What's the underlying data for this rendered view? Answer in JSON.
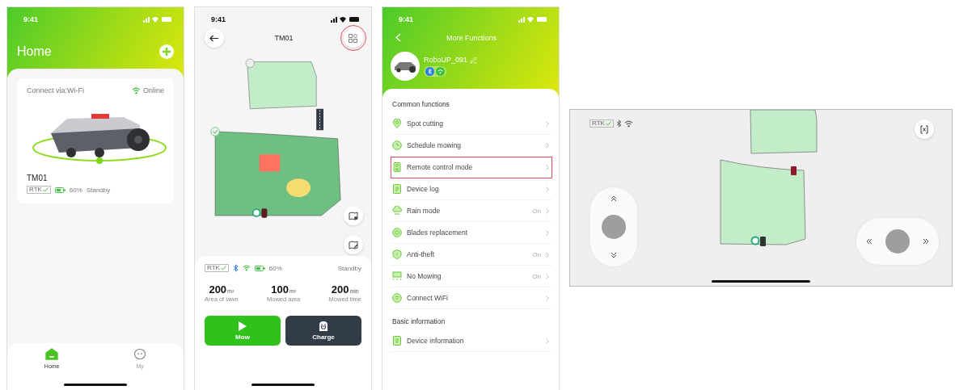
{
  "home_screen": {
    "status_time": "9:41",
    "title": "Home",
    "device_card": {
      "connection": "Connect via:Wi-Fi",
      "status": "Online",
      "name": "TM01",
      "rtk": "RTK",
      "battery": "60%",
      "state": "Standby"
    },
    "tab_bar": [
      {
        "label": "Home",
        "kind": "home",
        "selected": true
      },
      {
        "label": "My",
        "kind": "my",
        "selected": false
      }
    ]
  },
  "map_screen": {
    "status_time": "9:41",
    "title": "TM01",
    "menu_button": {
      "highlighted": true
    },
    "rtk": "RTK",
    "battery": "60%",
    "state": "Standby",
    "stats": [
      {
        "value": "200",
        "unit": "m²",
        "label": "Area of lawn"
      },
      {
        "value": "100",
        "unit": "m²",
        "label": "Mowed area"
      },
      {
        "value": "200",
        "unit": "min",
        "label": "Mowed time"
      }
    ],
    "buttons": [
      {
        "label": "Mow",
        "kind": "mow"
      },
      {
        "label": "Charge",
        "kind": "charge"
      }
    ]
  },
  "functions_screen": {
    "status_time": "9:41",
    "title": "More Functions",
    "device_name": "RoboUP_091",
    "sections": [
      {
        "title": "Common functions",
        "items": [
          {
            "label": "Spot cutting",
            "kind": "pin",
            "highlighted": false
          },
          {
            "label": "Schedule mowing",
            "kind": "clock",
            "highlighted": false
          },
          {
            "label": "Remote control mode",
            "kind": "remote",
            "highlighted": true
          },
          {
            "label": "Device log",
            "kind": "log",
            "highlighted": false
          },
          {
            "label": "Rain mode",
            "kind": "rain",
            "value": "On",
            "highlighted": false
          },
          {
            "label": "Blades replacement",
            "kind": "blade",
            "highlighted": false
          },
          {
            "label": "Anti-theft",
            "kind": "shield",
            "value": "On",
            "highlighted": false
          },
          {
            "label": "No Mowing",
            "kind": "nomow",
            "value": "On",
            "highlighted": false
          },
          {
            "label": "Connect WiFi",
            "kind": "wifi",
            "highlighted": false
          }
        ]
      },
      {
        "title": "Basic information",
        "items": [
          {
            "label": "Device information",
            "kind": "log",
            "highlighted": false
          }
        ]
      }
    ]
  },
  "remote_screen": {
    "rtk": "RTK"
  }
}
